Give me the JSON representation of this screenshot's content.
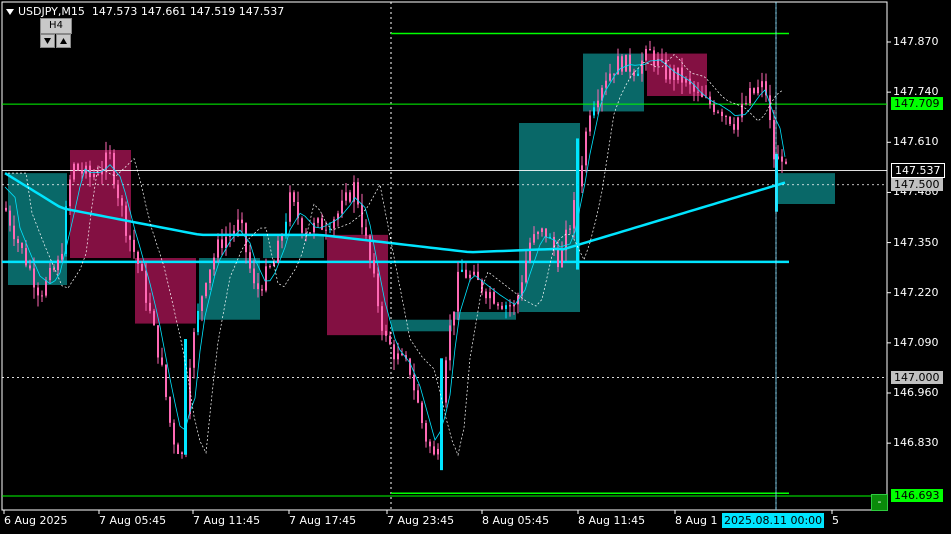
{
  "header": {
    "symbol": "USDJPY,M15",
    "quote": "147.573 147.661 147.519 147.537",
    "timeframe_button": "H4"
  },
  "price_axis": {
    "ticks": [
      "147.870",
      "147.740",
      "147.610",
      "147.480",
      "147.350",
      "147.220",
      "147.090",
      "146.960",
      "146.830"
    ],
    "tags": [
      {
        "text": "147.709",
        "bg": "#00ff00",
        "fg": "#000000"
      },
      {
        "text": "147.537",
        "bg": "#000000",
        "fg": "#ffffff"
      },
      {
        "text": "147.500",
        "bg": "#c0c0c0",
        "fg": "#000000"
      },
      {
        "text": "147.000",
        "bg": "#c0c0c0",
        "fg": "#000000"
      },
      {
        "text": "146.693",
        "bg": "#00ff00",
        "fg": "#000000"
      }
    ]
  },
  "time_axis": {
    "labels": [
      "6 Aug 2025",
      "7 Aug 05:45",
      "7 Aug 11:45",
      "7 Aug 17:45",
      "7 Aug 23:45",
      "8 Aug 05:45",
      "8 Aug 11:45",
      "8 Aug 1",
      "5"
    ],
    "cursor_time": "2025.08.11 00:00"
  },
  "controls": {
    "minus_button": "-"
  },
  "colors": {
    "background": "#000000",
    "candle": "#ff69b4",
    "candle_up": "#00e5ff",
    "level_line": "#00ff00",
    "ma": "#00e5ff",
    "htf_bull": "#0a6e6e",
    "htf_bear": "#8a1146"
  },
  "chart_data": {
    "type": "candlestick",
    "symbol": "USDJPY",
    "timeframe": "M15",
    "last_bar": {
      "open": 147.573,
      "high": 147.661,
      "low": 147.519,
      "close": 147.537
    },
    "levels": [
      147.709,
      147.537,
      147.5,
      147.0,
      146.693,
      147.892,
      147.3,
      146.7
    ],
    "y_range": [
      146.66,
      147.92
    ],
    "overlay_h4_boxes": [
      {
        "open": 147.53,
        "close": 147.24,
        "dir": "bull"
      },
      {
        "open": 147.59,
        "close": 147.31,
        "dir": "bear"
      },
      {
        "open": 147.31,
        "close": 147.14,
        "dir": "bear"
      },
      {
        "open": 147.15,
        "close": 147.31,
        "dir": "bull"
      },
      {
        "open": 147.31,
        "close": 147.37,
        "dir": "bull"
      },
      {
        "open": 147.37,
        "close": 147.11,
        "dir": "bear"
      },
      {
        "open": 147.12,
        "close": 147.15,
        "dir": "bull"
      },
      {
        "open": 147.15,
        "close": 147.17,
        "dir": "bull"
      },
      {
        "open": 147.17,
        "close": 147.66,
        "dir": "bull"
      },
      {
        "open": 147.69,
        "close": 147.84,
        "dir": "bull"
      },
      {
        "open": 147.84,
        "close": 147.73,
        "dir": "bear"
      },
      {
        "open": 147.45,
        "close": 147.53,
        "dir": "bull"
      }
    ]
  }
}
